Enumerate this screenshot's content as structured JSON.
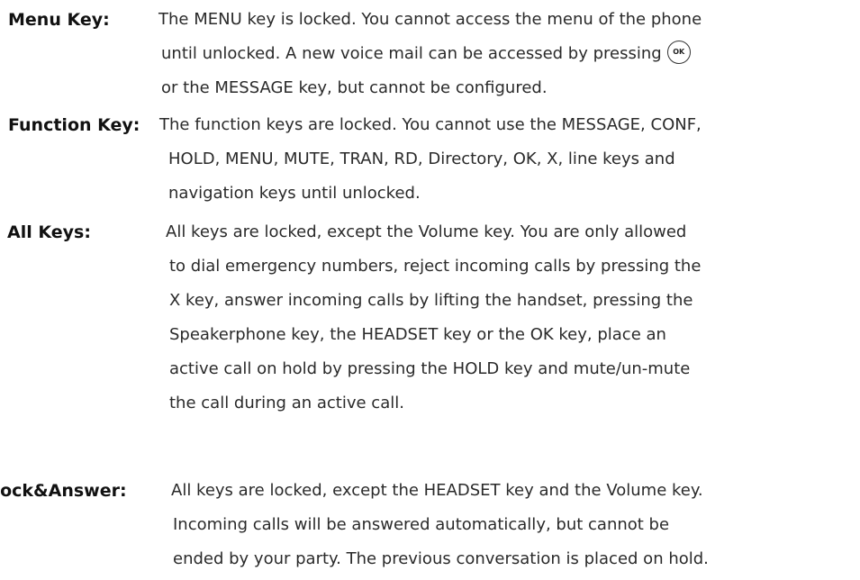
{
  "entries": [
    {
      "term": "Menu Key:",
      "lines": [
        "The MENU key is locked. You cannot access the menu of the phone",
        "until unlocked. A new voice mail can be accessed by pressing",
        "or the MESSAGE key, but cannot be configured."
      ],
      "icon": {
        "name": "ok-key-icon",
        "label": "OK"
      }
    },
    {
      "term": "Function Key:",
      "lines": [
        "The function keys are locked. You cannot use the MESSAGE, CONF,",
        "HOLD, MENU, MUTE, TRAN, RD, Directory, OK, X, line keys and",
        "navigation keys until unlocked."
      ]
    },
    {
      "term": "All Keys:",
      "lines": [
        "All keys are locked, except the Volume key. You are only allowed",
        "to dial emergency numbers, reject incoming calls by pressing the",
        "X key, answer incoming calls by lifting the handset, pressing the",
        "Speakerphone key, the HEADSET key or the OK key, place an",
        "active call on hold by pressing the HOLD key and mute/un-mute",
        "the call during an active call."
      ]
    },
    {
      "term": "Lock&Answer:",
      "lines": [
        "All keys are locked, except the HEADSET key and the Volume key.",
        "Incoming calls will be answered automatically, but cannot be",
        "ended by your party. The previous conversation is placed on hold."
      ]
    }
  ]
}
